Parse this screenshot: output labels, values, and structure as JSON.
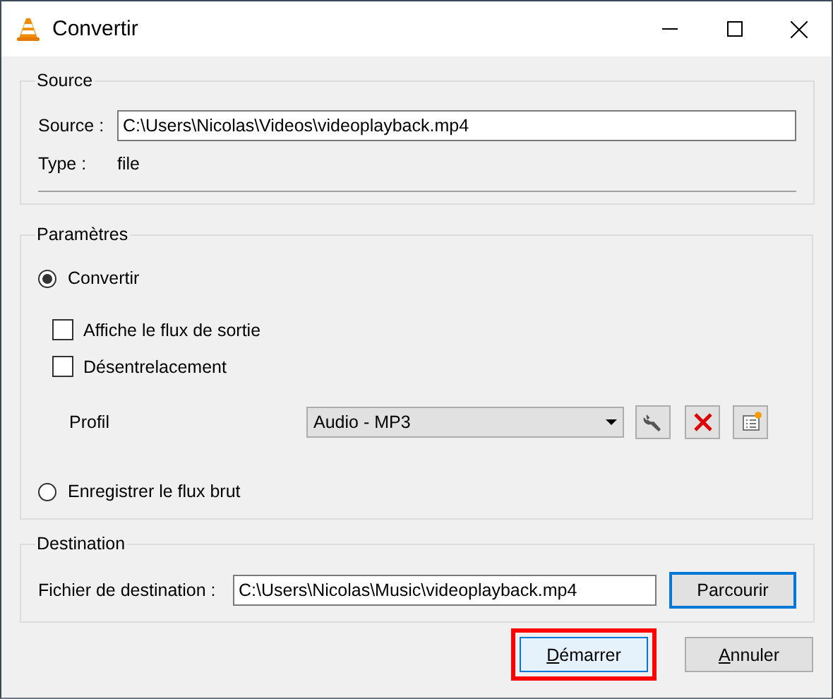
{
  "window": {
    "title": "Convertir"
  },
  "source": {
    "title": "Source",
    "source_label": "Source :",
    "source_value": "C:\\Users\\Nicolas\\Videos\\videoplayback.mp4",
    "type_label": "Type :",
    "type_value": "file"
  },
  "settings": {
    "title": "Paramètres",
    "modes": [
      {
        "label": "Convertir",
        "selected": true
      },
      {
        "label": "Enregistrer le flux brut",
        "selected": false
      }
    ],
    "options": [
      {
        "label": "Affiche le flux de sortie",
        "checked": false
      },
      {
        "label": "Désentrelacement",
        "checked": false
      }
    ],
    "profile": {
      "label": "Profil",
      "value": "Audio - MP3"
    }
  },
  "destination": {
    "title": "Destination",
    "label": "Fichier de destination :",
    "value": "C:\\Users\\Nicolas\\Music\\videoplayback.mp4",
    "browse": {
      "label": "Parcourir",
      "focused": true
    }
  },
  "buttons": [
    {
      "label": "Démarrer",
      "highlighted": true
    },
    {
      "label": "Annuler",
      "highlighted": false
    }
  ]
}
